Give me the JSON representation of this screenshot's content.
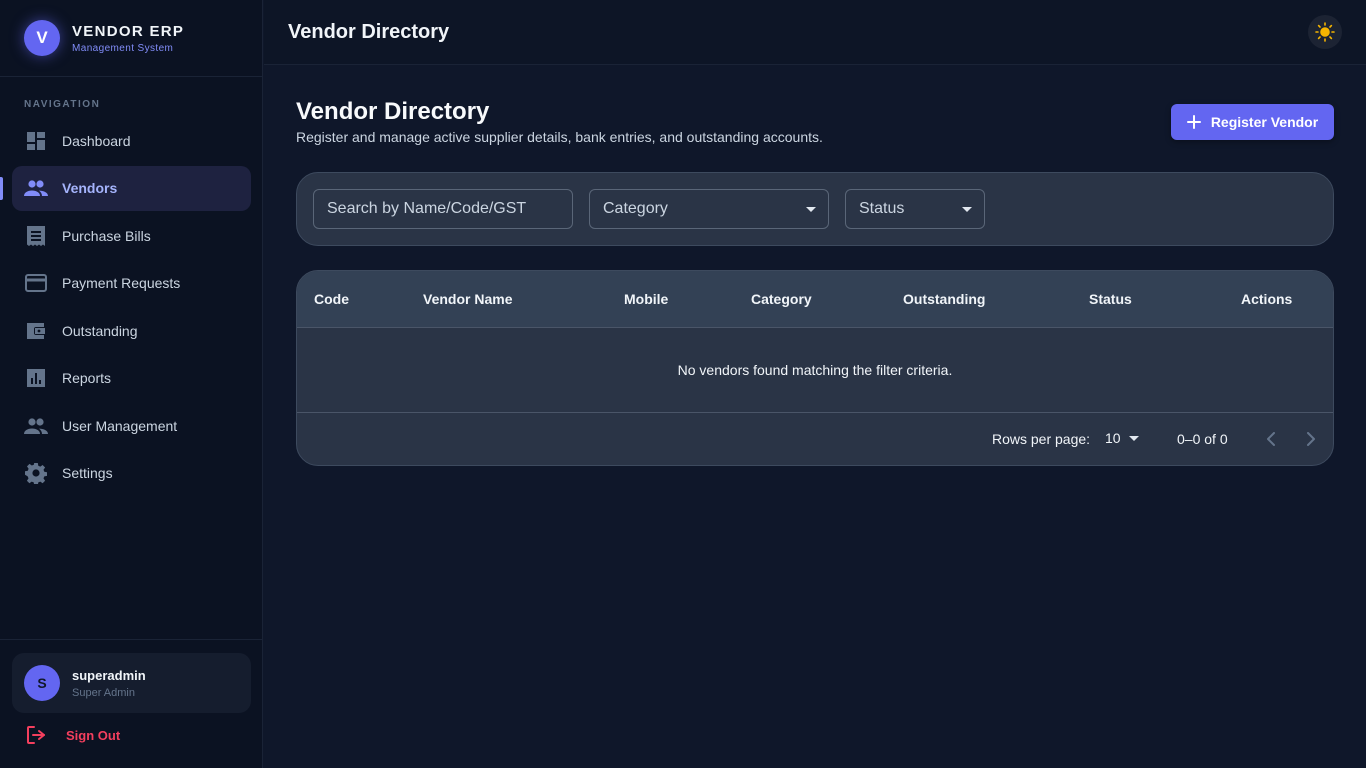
{
  "brand": {
    "logo_letter": "V",
    "title": "VENDOR ERP",
    "subtitle": "Management System"
  },
  "sidebar": {
    "heading": "NAVIGATION",
    "items": [
      {
        "label": "Dashboard",
        "icon": "dashboard-icon",
        "active": false
      },
      {
        "label": "Vendors",
        "icon": "people-icon",
        "active": true
      },
      {
        "label": "Purchase Bills",
        "icon": "receipt-icon",
        "active": false
      },
      {
        "label": "Payment Requests",
        "icon": "credit-card-icon",
        "active": false
      },
      {
        "label": "Outstanding",
        "icon": "wallet-icon",
        "active": false
      },
      {
        "label": "Reports",
        "icon": "bar-chart-icon",
        "active": false
      },
      {
        "label": "User Management",
        "icon": "group-icon",
        "active": false
      },
      {
        "label": "Settings",
        "icon": "gear-icon",
        "active": false
      }
    ]
  },
  "user": {
    "avatar_letter": "S",
    "name": "superadmin",
    "role": "Super Admin"
  },
  "signout": {
    "label": "Sign Out"
  },
  "header": {
    "title": "Vendor Directory",
    "theme_icon": "sun-icon"
  },
  "page": {
    "title": "Vendor Directory",
    "subtitle": "Register and manage active supplier details, bank entries, and outstanding accounts.",
    "register_label": "Register Vendor"
  },
  "filters": {
    "search_placeholder": "Search by Name/Code/GST",
    "category_label": "Category",
    "status_label": "Status"
  },
  "table": {
    "columns": [
      "Code",
      "Vendor Name",
      "Mobile",
      "Category",
      "Outstanding",
      "Status",
      "Actions"
    ],
    "empty_message": "No vendors found matching the filter criteria.",
    "rows_per_page_label": "Rows per page:",
    "rows_per_page": "10",
    "range": "0–0 of 0"
  },
  "colors": {
    "accent": "#6366f1",
    "background": "#0f172a",
    "danger": "#f43f5e",
    "sun": "#f5b400"
  }
}
